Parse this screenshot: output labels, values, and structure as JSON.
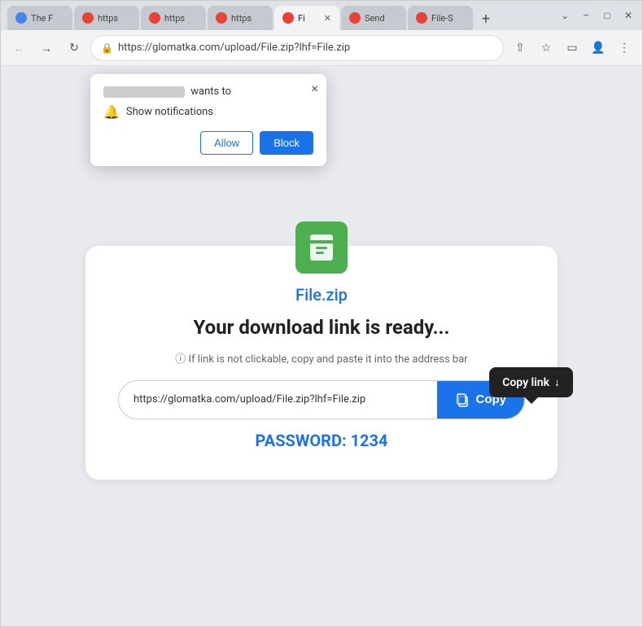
{
  "browser": {
    "tabs": [
      {
        "label": "The F",
        "active": false,
        "icon": "🌐"
      },
      {
        "label": "https",
        "active": false,
        "icon": "🌐"
      },
      {
        "label": "https",
        "active": false,
        "icon": "🌐"
      },
      {
        "label": "https",
        "active": false,
        "icon": "🌐"
      },
      {
        "label": "Fi",
        "active": true,
        "icon": "🌐"
      },
      {
        "label": "Send",
        "active": false,
        "icon": "🌐"
      },
      {
        "label": "File-S",
        "active": false,
        "icon": "🌐"
      }
    ],
    "address": "https://glomatka.com/upload/File.zip?lhf=File.zip",
    "window_controls": {
      "minimize": "–",
      "maximize": "□",
      "close": "✕",
      "chevron": "⌄"
    }
  },
  "notification": {
    "site_blurred": "blur",
    "wants_to": "wants to",
    "permission_label": "Show notifications",
    "allow_btn": "Allow",
    "block_btn": "Block",
    "close": "×"
  },
  "main_card": {
    "file_icon": "🗂",
    "file_name": "File.zip",
    "download_title": "Your download link is ready...",
    "hint_text": "ⓘ If link is not clickable, copy and paste it into the address bar",
    "link_url": "https://glomatka.com/upload/File.zip?lhf=File.zip",
    "copy_btn_label": "Copy",
    "password_label": "PASSWORD: 1234"
  },
  "tooltip": {
    "label": "Copy link",
    "arrow": "↓"
  }
}
